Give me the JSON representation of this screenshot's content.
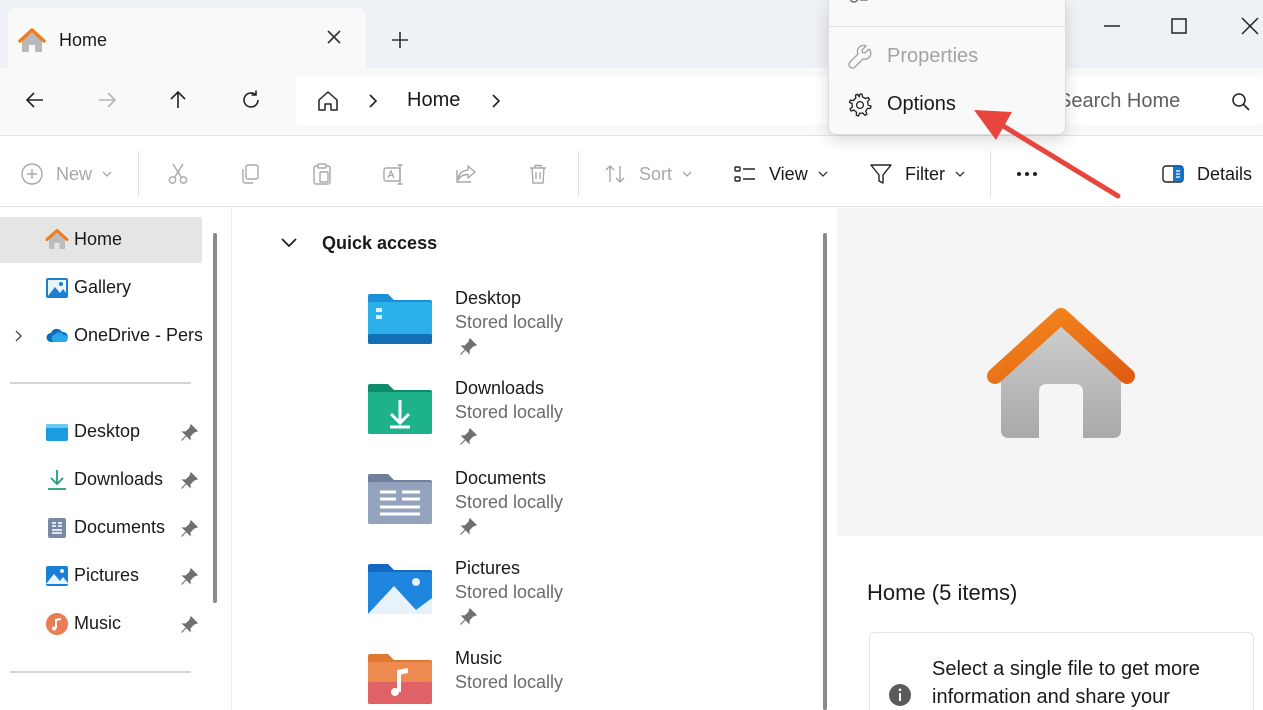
{
  "tab": {
    "title": "Home"
  },
  "address": {
    "crumb": "Home",
    "search_placeholder": "Search Home"
  },
  "toolbar": {
    "new_label": "New",
    "sort_label": "Sort",
    "view_label": "View",
    "filter_label": "Filter",
    "details_label": "Details"
  },
  "sidebar": {
    "top_items": [
      {
        "label": "Home",
        "icon": "home-icon"
      },
      {
        "label": "Gallery",
        "icon": "gallery-icon"
      },
      {
        "label": "OneDrive - Personal",
        "icon": "onedrive-icon"
      }
    ],
    "pinned_items": [
      {
        "label": "Desktop",
        "icon": "desktop-folder-icon"
      },
      {
        "label": "Downloads",
        "icon": "download-icon"
      },
      {
        "label": "Documents",
        "icon": "documents-icon"
      },
      {
        "label": "Pictures",
        "icon": "pictures-icon"
      },
      {
        "label": "Music",
        "icon": "music-icon"
      }
    ]
  },
  "quick_access": {
    "title": "Quick access",
    "folders": [
      {
        "name": "Desktop",
        "status": "Stored locally"
      },
      {
        "name": "Downloads",
        "status": "Stored locally"
      },
      {
        "name": "Documents",
        "status": "Stored locally"
      },
      {
        "name": "Pictures",
        "status": "Stored locally"
      },
      {
        "name": "Music",
        "status": "Stored locally"
      }
    ]
  },
  "details": {
    "title": "Home (5 items)",
    "info": "Select a single file to get more information and share your"
  },
  "menu": {
    "properties_label": "Properties",
    "options_label": "Options"
  },
  "colors": {
    "accent": "#0067c0",
    "home_orange": "#f07c1a",
    "arrow_red": "#e8453c"
  }
}
